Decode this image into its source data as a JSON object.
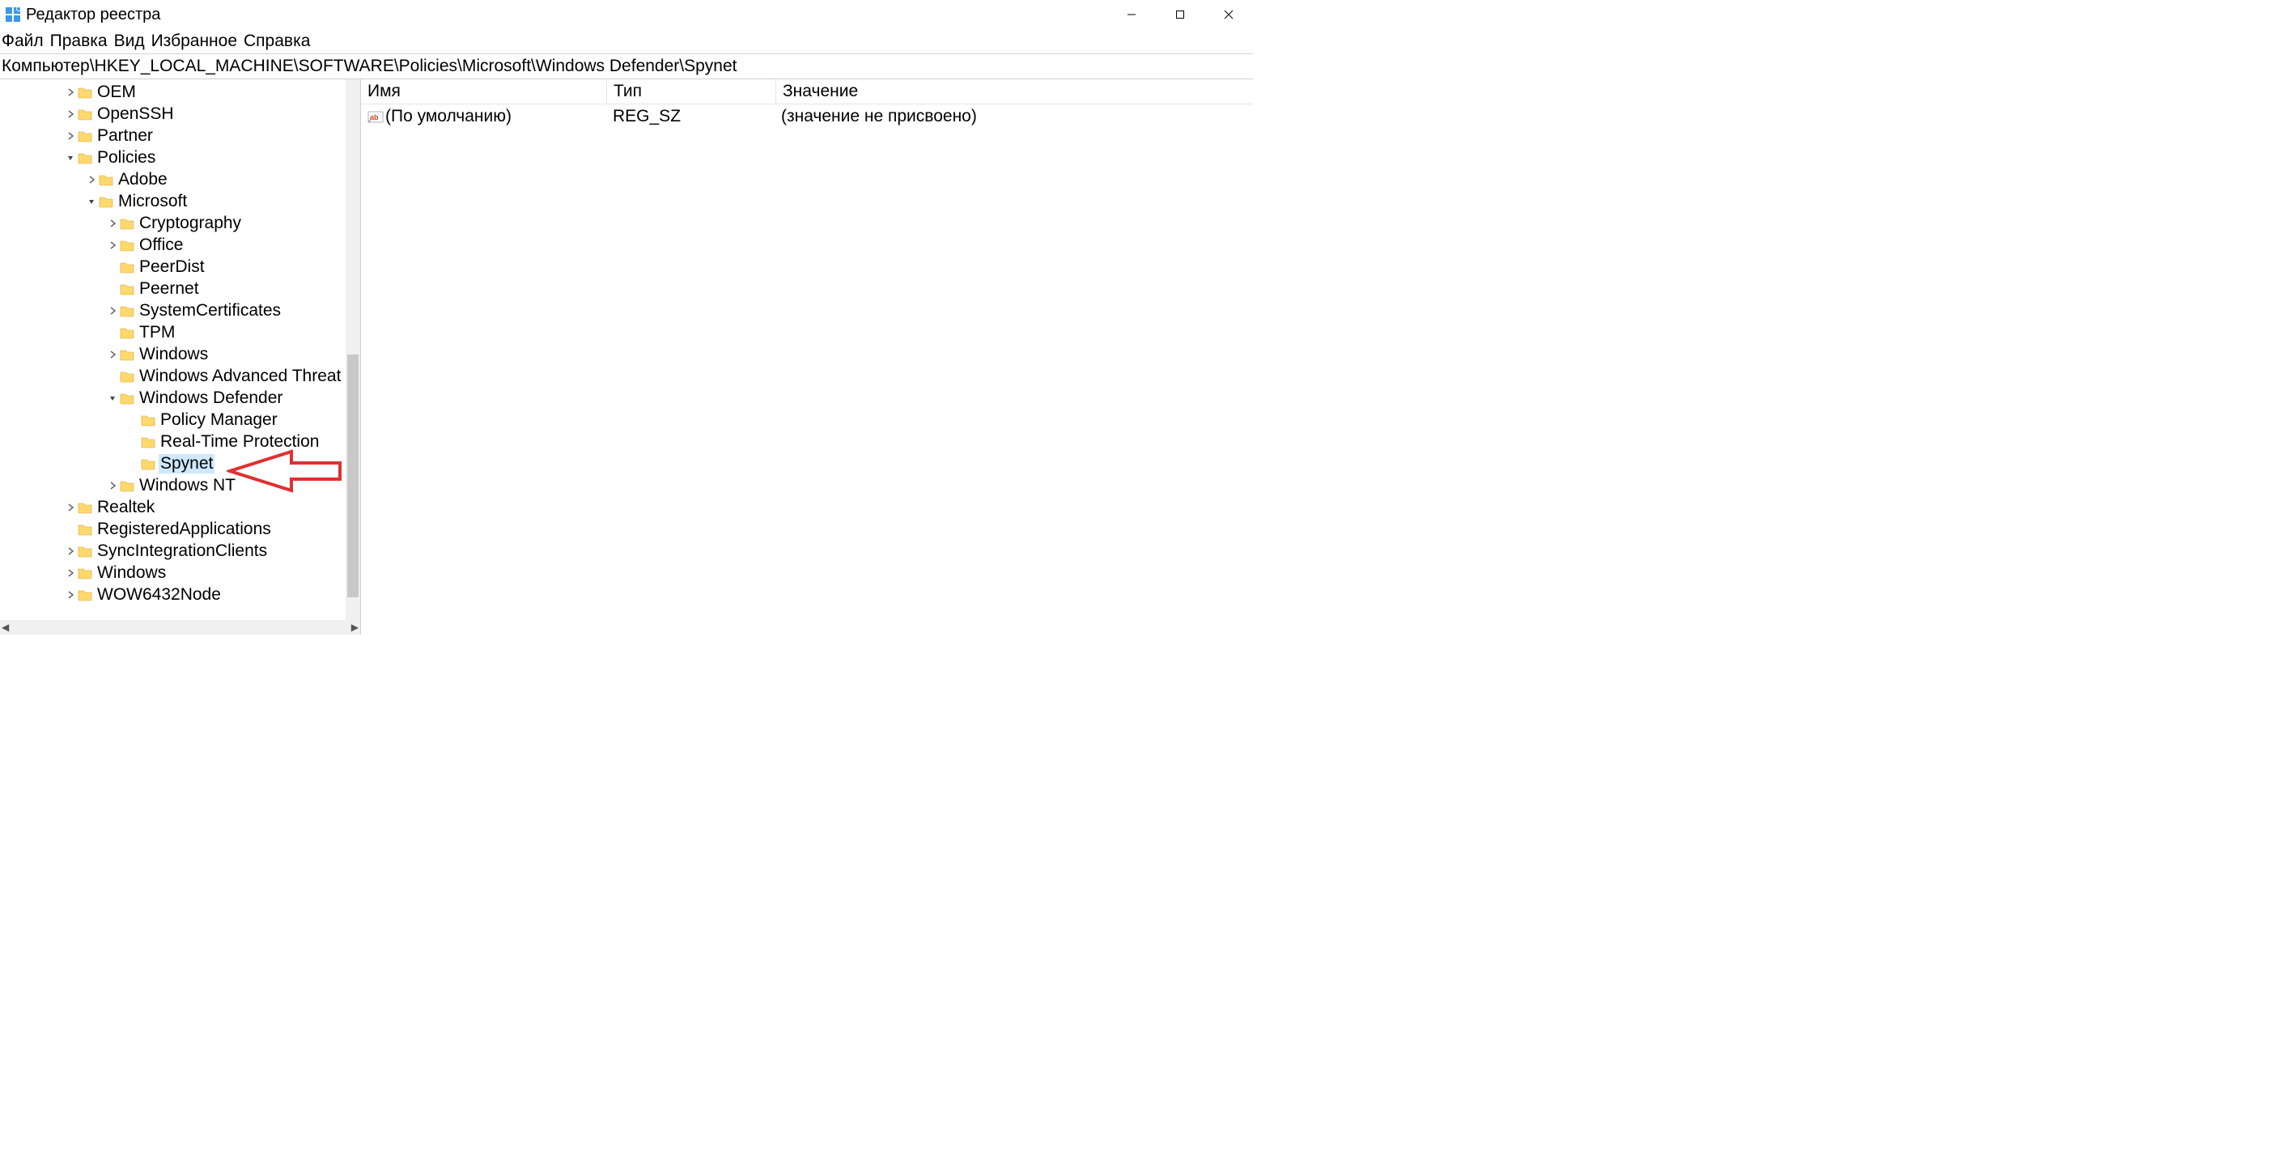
{
  "window": {
    "title": "Редактор реестра"
  },
  "menu": [
    "Файл",
    "Правка",
    "Вид",
    "Избранное",
    "Справка"
  ],
  "address": "Компьютер\\HKEY_LOCAL_MACHINE\\SOFTWARE\\Policies\\Microsoft\\Windows Defender\\Spynet",
  "tree": [
    {
      "indent": 3,
      "exp": ">",
      "label": "OEM"
    },
    {
      "indent": 3,
      "exp": ">",
      "label": "OpenSSH"
    },
    {
      "indent": 3,
      "exp": ">",
      "label": "Partner"
    },
    {
      "indent": 3,
      "exp": "v",
      "label": "Policies"
    },
    {
      "indent": 4,
      "exp": ">",
      "label": "Adobe"
    },
    {
      "indent": 4,
      "exp": "v",
      "label": "Microsoft"
    },
    {
      "indent": 5,
      "exp": ">",
      "label": "Cryptography"
    },
    {
      "indent": 5,
      "exp": ">",
      "label": "Office"
    },
    {
      "indent": 5,
      "exp": "",
      "label": "PeerDist"
    },
    {
      "indent": 5,
      "exp": "",
      "label": "Peernet"
    },
    {
      "indent": 5,
      "exp": ">",
      "label": "SystemCertificates"
    },
    {
      "indent": 5,
      "exp": "",
      "label": "TPM"
    },
    {
      "indent": 5,
      "exp": ">",
      "label": "Windows"
    },
    {
      "indent": 5,
      "exp": "",
      "label": "Windows Advanced Threat Protection"
    },
    {
      "indent": 5,
      "exp": "v",
      "label": "Windows Defender"
    },
    {
      "indent": 6,
      "exp": "",
      "label": "Policy Manager"
    },
    {
      "indent": 6,
      "exp": "",
      "label": "Real-Time Protection"
    },
    {
      "indent": 6,
      "exp": "",
      "label": "Spynet",
      "selected": true
    },
    {
      "indent": 5,
      "exp": ">",
      "label": "Windows NT"
    },
    {
      "indent": 3,
      "exp": ">",
      "label": "Realtek"
    },
    {
      "indent": 3,
      "exp": "",
      "label": "RegisteredApplications"
    },
    {
      "indent": 3,
      "exp": ">",
      "label": "SyncIntegrationClients"
    },
    {
      "indent": 3,
      "exp": ">",
      "label": "Windows"
    },
    {
      "indent": 3,
      "exp": ">",
      "label": "WOW6432Node"
    }
  ],
  "columns": {
    "name": "Имя",
    "type": "Тип",
    "value": "Значение"
  },
  "values": [
    {
      "name": "(По умолчанию)",
      "type": "REG_SZ",
      "value": "(значение не присвоено)"
    }
  ]
}
